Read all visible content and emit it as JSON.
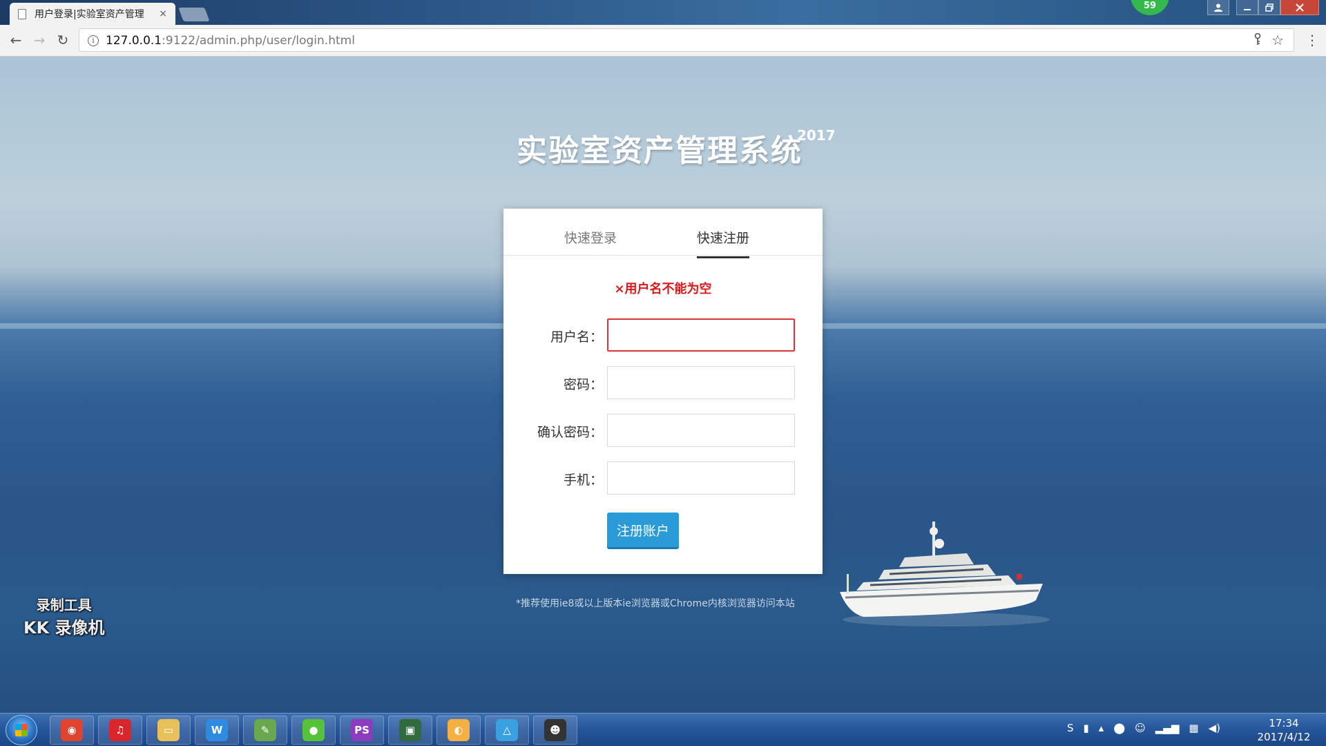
{
  "browser": {
    "tab_title": "用户登录|实验室资产管理",
    "tab_close": "×",
    "notification_badge": "59",
    "url_host": "127.0.0.1",
    "url_rest": ":9122/admin.php/user/login.html"
  },
  "page": {
    "system_title": "实验室资产管理系统",
    "year": "2017",
    "tabs": {
      "login": "快速登录",
      "register": "快速注册",
      "active": "register"
    },
    "error_message": "×用户名不能为空",
    "fields": {
      "username": {
        "label": "用户名：",
        "value": ""
      },
      "password": {
        "label": "密码：",
        "value": ""
      },
      "confirm_password": {
        "label": "确认密码：",
        "value": ""
      },
      "phone": {
        "label": "手机：",
        "value": ""
      }
    },
    "submit_label": "注册账户",
    "footnote": "*推荐使用ie8或以上版本ie浏览器或Chrome内核浏览器访问本站"
  },
  "watermark": {
    "line1": "录制工具",
    "line2": "KK 录像机"
  },
  "taskbar": {
    "apps": [
      {
        "icon": "chrome-icon",
        "color": "#e0442f"
      },
      {
        "icon": "netease-music-icon",
        "color": "#d9262c"
      },
      {
        "icon": "file-explorer-icon",
        "color": "#e9c15a"
      },
      {
        "icon": "wps-writer-icon",
        "color": "#2e8be0"
      },
      {
        "icon": "notepad-plus-icon",
        "color": "#6aa84f"
      },
      {
        "icon": "green-app-icon",
        "color": "#56c23a"
      },
      {
        "icon": "phpstorm-icon",
        "color": "#8b3dbd"
      },
      {
        "icon": "terminal-monitor-icon",
        "color": "#2f6b3c"
      },
      {
        "icon": "paint-palette-icon",
        "color": "#f4b043"
      },
      {
        "icon": "network-app-icon",
        "color": "#3aa1e0"
      },
      {
        "icon": "kk-recorder-icon",
        "color": "#333333"
      }
    ],
    "tray_icons": [
      "sogou-input-icon",
      "battery-icon",
      "show-hidden-arrow-icon",
      "security-icon",
      "qq-icon",
      "signal-icon",
      "network-icon",
      "volume-icon"
    ],
    "clock_time": "17:34",
    "clock_date": "2017/4/12"
  }
}
